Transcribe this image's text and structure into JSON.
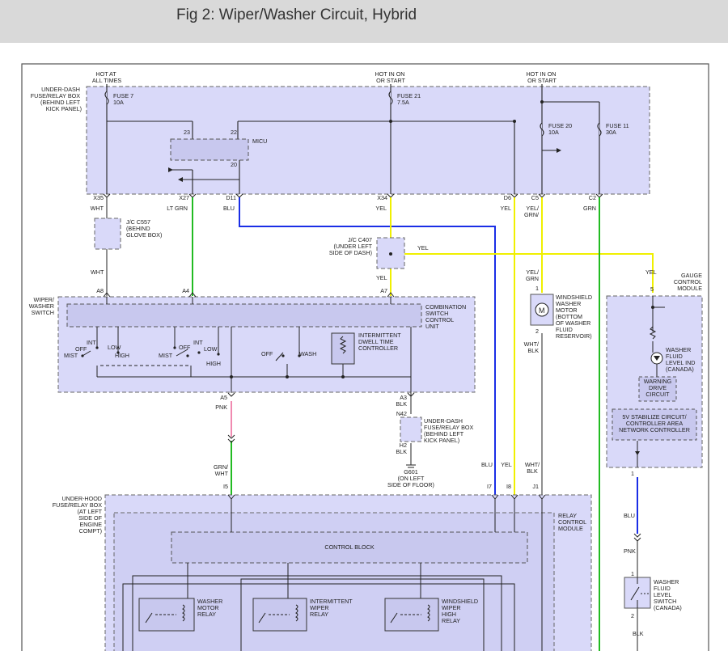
{
  "header": {
    "title": "Fig 2: Wiper/Washer Circuit, Hybrid"
  },
  "colors": {
    "header_bg": "#d9d9d9",
    "module_fill": "#d9d9f9",
    "wire_green": "#22bb22",
    "wire_blue": "#1a2ee6",
    "wire_yellow": "#f0f000",
    "wire_pink": "#f08ab0",
    "wire_default": "#333333"
  },
  "power": {
    "hot_at_all_times": [
      "HOT AT",
      "ALL TIMES"
    ],
    "hot_in_on_1": [
      "HOT IN ON",
      "OR START"
    ],
    "hot_in_on_2": [
      "HOT IN ON",
      "OR START"
    ]
  },
  "underdash_box": {
    "label": [
      "UNDER-DASH",
      "FUSE/RELAY BOX",
      "(BEHIND LEFT",
      "KICK PANEL)"
    ],
    "fuse7": [
      "FUSE 7",
      "10A"
    ],
    "fuse21": [
      "FUSE 21",
      "7.5A"
    ],
    "fuse20": [
      "FUSE 20",
      "10A"
    ],
    "fuse11": [
      "FUSE 11",
      "30A"
    ],
    "micu": "MICU",
    "pin23": "23",
    "pin22": "22",
    "pin20": "20",
    "terminals": [
      "X35",
      "X27",
      "D11",
      "X34",
      "D6",
      "C5",
      "C2"
    ],
    "wires": [
      "WHT",
      "LT GRN",
      "BLU",
      "YEL",
      "YEL",
      "YEL/",
      "GRN/",
      "GRN"
    ]
  },
  "jc_c557": {
    "label": [
      "J/C C557",
      "(BEHIND",
      "GLOVE BOX)"
    ],
    "wire": "WHT"
  },
  "jc_c407": {
    "label": [
      "J/C C407",
      "(UNDER LEFT",
      "SIDE OF DASH)"
    ],
    "wire_out": "YEL"
  },
  "wiper_switch": {
    "label": [
      "WIPER/",
      "WASHER",
      "SWITCH"
    ],
    "terminals": [
      "A8",
      "A4",
      "A7"
    ],
    "csu": [
      "COMBINATION",
      "SWITCH",
      "CONTROL",
      "UNIT"
    ],
    "modes_left": {
      "int": "INT",
      "off": "OFF",
      "low": "LOW",
      "high": "HIGH",
      "mist": "MIST"
    },
    "modes_mid": {
      "int": "INT",
      "off": "OFF",
      "low": "LOW",
      "high": "HIGH",
      "mist": "MIST"
    },
    "washer_off": "OFF",
    "washer": "WASH",
    "dwell": [
      "INTERMITTENT",
      "DWELL TIME",
      "CONTROLLER"
    ],
    "bottom_terminals": [
      "A5",
      "A3"
    ],
    "bottom_wires": [
      "PNK",
      "BLK"
    ]
  },
  "washer_motor": {
    "label": [
      "WINDSHIELD",
      "WASHER",
      "MOTOR",
      "(BOTTOM",
      "OF WASHER",
      "FLUID",
      "RESERVOIR)"
    ],
    "pin1": "1",
    "pin2": "2",
    "wire_top": [
      "YEL/",
      "GRN"
    ],
    "wire_bottom": [
      "WHT/",
      "BLK"
    ]
  },
  "gauge_module": {
    "label": [
      "GAUGE",
      "CONTROL",
      "MODULE"
    ],
    "pin5": "5",
    "pin1": "1",
    "wire_in": "YEL",
    "indicator": [
      "WASHER",
      "FLUID",
      "LEVEL IND",
      "(CANADA)"
    ],
    "warning": [
      "WARNING",
      "DRIVE",
      "CIRCUIT"
    ],
    "stabilize": [
      "5V STABILIZE CIRCUIT/",
      "CONTROLLER AREA",
      "NETWORK CONTROLLER"
    ]
  },
  "ground_box": {
    "label": [
      "UNDER-DASH",
      "FUSE/RELAY BOX",
      "(BEHIND LEFT",
      "KICK PANEL)"
    ],
    "n42": "N42",
    "h2": "H2",
    "wire": "BLK",
    "g601": [
      "G601",
      "(ON LEFT",
      "SIDE OF FLOOR)"
    ]
  },
  "underhood": {
    "label": [
      "UNDER-HOOD",
      "FUSE/RELAY BOX",
      "(AT LEFT",
      "SIDE OF",
      "ENGINE",
      "COMPT)"
    ],
    "relay_module": [
      "RELAY",
      "CONTROL",
      "MODULE"
    ],
    "control_block": "CONTROL BLOCK",
    "terminals": [
      "I5",
      "I7",
      "I8",
      "J1"
    ],
    "wires_in": [
      "GRN/",
      "WHT",
      "BLU",
      "YEL",
      "WHT/",
      "BLK"
    ],
    "relay1": [
      "WASHER",
      "MOTOR",
      "RELAY"
    ],
    "relay2": [
      "INTERMITTENT",
      "WIPER",
      "RELAY"
    ],
    "relay3": [
      "WINDSHIELD",
      "WIPER",
      "HIGH",
      "RELAY"
    ]
  },
  "level_switch": {
    "label": [
      "WASHER",
      "FLUID",
      "LEVEL",
      "SWITCH",
      "(CANADA)"
    ],
    "wire_top": "BLU",
    "wire_mid": "PNK",
    "pin1": "1",
    "pin2": "2",
    "wire_bottom": "BLK"
  }
}
